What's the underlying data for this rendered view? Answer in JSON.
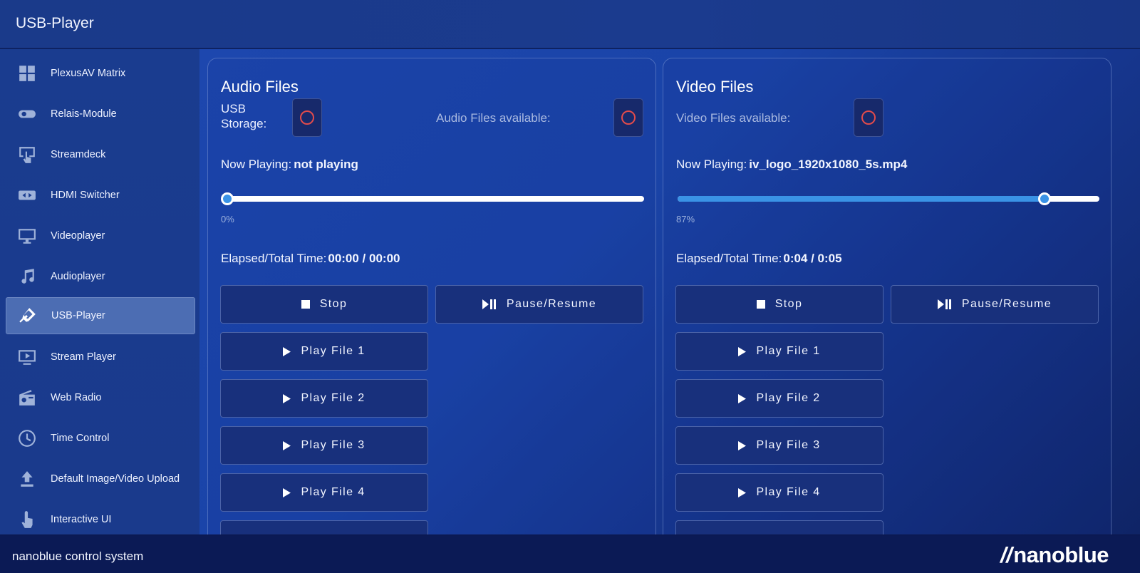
{
  "header": {
    "title": "USB-Player"
  },
  "sidebar": {
    "items": [
      {
        "label": "PlexusAV Matrix",
        "icon": "grid-icon"
      },
      {
        "label": "Relais-Module",
        "icon": "toggle-icon"
      },
      {
        "label": "Streamdeck",
        "icon": "touch-screen-icon"
      },
      {
        "label": "HDMI Switcher",
        "icon": "switch-arrows-icon"
      },
      {
        "label": "Videoplayer",
        "icon": "monitor-icon"
      },
      {
        "label": "Audioplayer",
        "icon": "music-note-icon"
      },
      {
        "label": "USB-Player",
        "icon": "usb-icon",
        "active": true
      },
      {
        "label": "Stream Player",
        "icon": "play-screen-icon"
      },
      {
        "label": "Web Radio",
        "icon": "radio-icon"
      },
      {
        "label": "Time Control",
        "icon": "clock-icon"
      },
      {
        "label": "Default Image/Video Upload",
        "icon": "upload-icon"
      },
      {
        "label": "Interactive UI",
        "icon": "pointer-hand-icon"
      }
    ]
  },
  "audio": {
    "title": "Audio Files",
    "usb_storage_label": "USB Storage:",
    "files_available_label": "Audio Files available:",
    "now_playing_label": "Now Playing:",
    "now_playing_value": "not playing",
    "progress_percent": 0,
    "progress_text": "0%",
    "elapsed_label": "Elapsed/Total Time:",
    "elapsed_value": "00:00 / 00:00",
    "stop_label": "Stop",
    "pause_label": "Pause/Resume",
    "play_buttons": [
      "Play File 1",
      "Play File 2",
      "Play File 3",
      "Play File 4"
    ]
  },
  "video": {
    "title": "Video Files",
    "files_available_label": "Video Files available:",
    "now_playing_label": "Now Playing:",
    "now_playing_value": "iv_logo_1920x1080_5s.mp4",
    "progress_percent": 87,
    "progress_text": "87%",
    "elapsed_label": "Elapsed/Total Time:",
    "elapsed_value": "0:04 / 0:05",
    "stop_label": "Stop",
    "pause_label": "Pause/Resume",
    "play_buttons": [
      "Play File 1",
      "Play File 2",
      "Play File 3",
      "Play File 4"
    ]
  },
  "footer": {
    "text": "nanoblue control system",
    "logo": "nanoblue",
    "logo_mark": "//"
  },
  "colors": {
    "accent": "#3a93e6",
    "indicator_off": "#e14b4b",
    "active_item": "#4c6db3"
  }
}
